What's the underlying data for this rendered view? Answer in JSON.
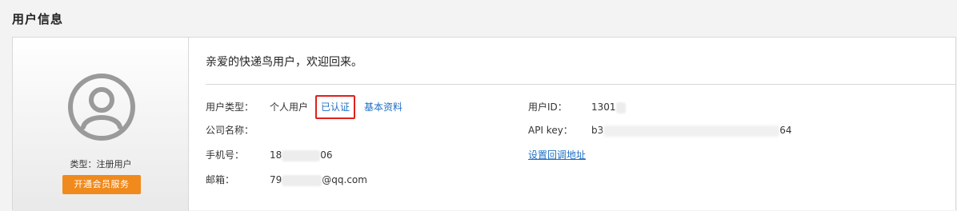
{
  "header": {
    "title": "用户信息"
  },
  "profile": {
    "avatar_icon": "user-avatar-icon",
    "user_type_text": "类型：注册用户",
    "vip_button_label": "开通会员服务"
  },
  "welcome": {
    "text": "亲爱的快递鸟用户，欢迎回来。"
  },
  "info": {
    "user_type_label": "用户类型：",
    "user_type_value": "个人用户",
    "verified_label": "已认证",
    "basic_info_link": "基本资料",
    "company_label": "公司名称：",
    "company_value": "",
    "phone_label": "手机号：",
    "phone_prefix": "18",
    "phone_suffix": "06",
    "email_label": "邮箱：",
    "email_prefix": "79",
    "email_suffix": "@qq.com",
    "user_id_label": "用户ID：",
    "user_id_value": "1301",
    "api_key_label": "API key：",
    "api_key_prefix": "b3",
    "api_key_suffix": "64",
    "callback_link": "设置回调地址"
  },
  "colors": {
    "accent_orange": "#f08a1c",
    "link_blue": "#1f6fc5",
    "highlight_red": "#e0201b"
  }
}
